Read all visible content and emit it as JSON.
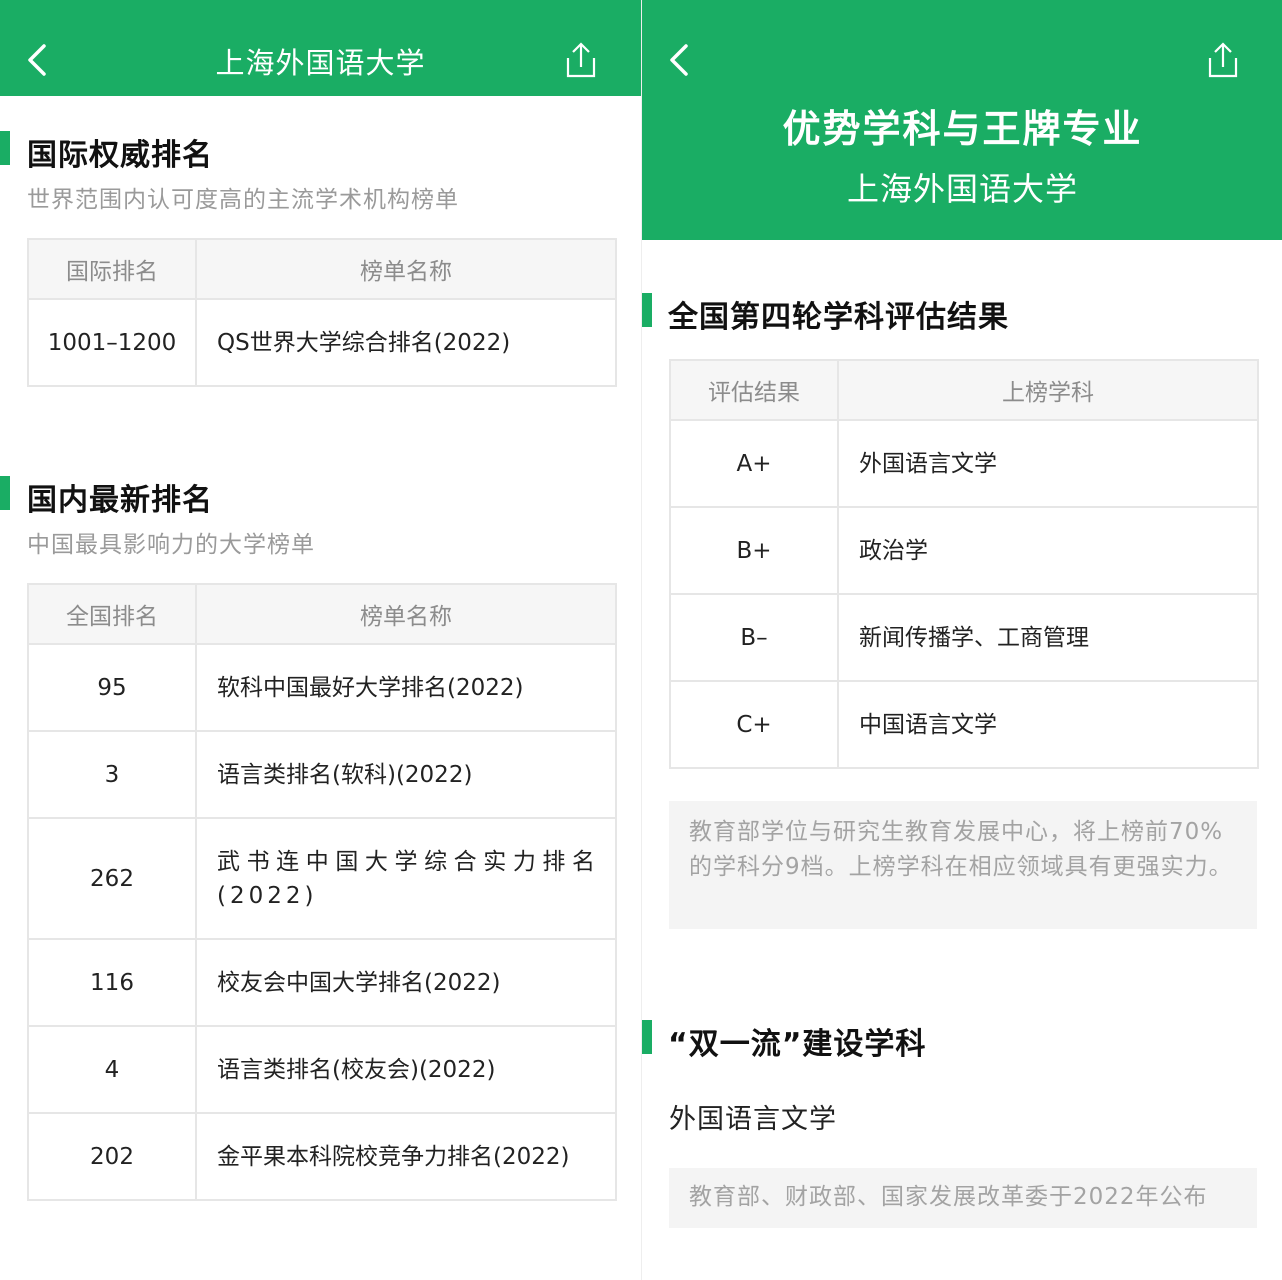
{
  "left": {
    "nav_title": "上海外国语大学",
    "intl": {
      "title": "国际权威排名",
      "subtitle": "世界范围内认可度高的主流学术机构榜单",
      "headers": [
        "国际排名",
        "榜单名称"
      ],
      "rows": [
        {
          "rank": "1001–1200",
          "name": "QS世界大学综合排名(2022)"
        }
      ]
    },
    "domestic": {
      "title": "国内最新排名",
      "subtitle": "中国最具影响力的大学榜单",
      "headers": [
        "全国排名",
        "榜单名称"
      ],
      "rows": [
        {
          "rank": "95",
          "name": "软科中国最好大学排名(2022)"
        },
        {
          "rank": "3",
          "name": "语言类排名(软科)(2022)"
        },
        {
          "rank": "262",
          "name": "武书连中国大学综合实力排名(2022)"
        },
        {
          "rank": "116",
          "name": "校友会中国大学排名(2022)"
        },
        {
          "rank": "4",
          "name": "语言类排名(校友会)(2022)"
        },
        {
          "rank": "202",
          "name": "金平果本科院校竞争力排名(2022)"
        }
      ]
    }
  },
  "right": {
    "hero_title": "优势学科与王牌专业",
    "hero_subtitle": "上海外国语大学",
    "eval": {
      "title": "全国第四轮学科评估结果",
      "headers": [
        "评估结果",
        "上榜学科"
      ],
      "rows": [
        {
          "grade": "A+",
          "subject": "外国语言文学"
        },
        {
          "grade": "B+",
          "subject": "政治学"
        },
        {
          "grade": "B–",
          "subject": "新闻传播学、工商管理"
        },
        {
          "grade": "C+",
          "subject": "中国语言文学"
        }
      ],
      "note": "教育部学位与研究生教育发展中心，将上榜前70%的学科分9档。上榜学科在相应领域具有更强实力。"
    },
    "double": {
      "title": "“双一流”建设学科",
      "subject": "外国语言文学",
      "note": "教育部、财政部、国家发展改革委于2022年公布"
    }
  },
  "icons": {
    "back": "chevron-left-icon",
    "share": "share-icon"
  },
  "colors": {
    "brand": "#1aad64",
    "header_bg": "#f6f6f6",
    "muted_text": "#9a9a9a"
  }
}
